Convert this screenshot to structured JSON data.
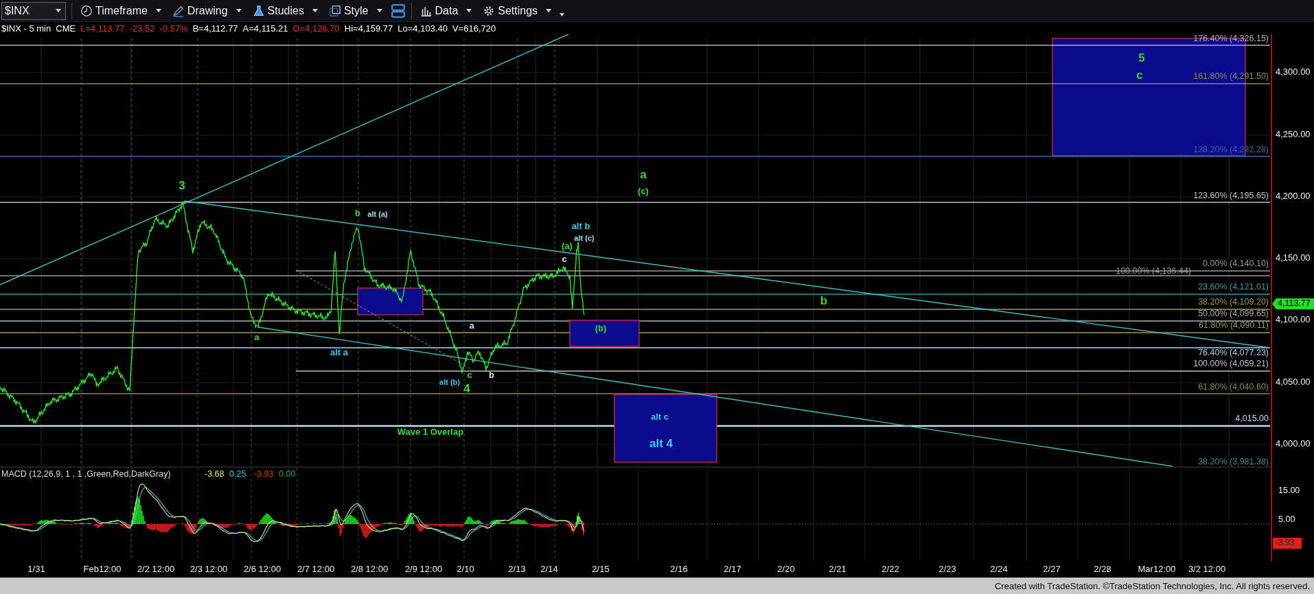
{
  "toolbar": {
    "symbol": "$INX",
    "buttons": [
      {
        "label": "Timeframe"
      },
      {
        "label": "Drawing"
      },
      {
        "label": "Studies"
      },
      {
        "label": "Style"
      },
      {
        "label": "Data"
      },
      {
        "label": "Settings"
      }
    ]
  },
  "info_line": [
    {
      "text": "$INX - 5 min",
      "color": "#ffffff"
    },
    {
      "text": "CME",
      "color": "#ffffff"
    },
    {
      "text": "L=4,113.77",
      "color": "#e03030"
    },
    {
      "text": "-23.52",
      "color": "#e03030"
    },
    {
      "text": "-0.57%",
      "color": "#e03030"
    },
    {
      "text": "B=4,112.77",
      "color": "#ffffff"
    },
    {
      "text": "A=4,115.21",
      "color": "#ffffff"
    },
    {
      "text": "O=4,126.70",
      "color": "#e03030"
    },
    {
      "text": "Hi=4,159.77",
      "color": "#ffffff"
    },
    {
      "text": "Lo=4,103.40",
      "color": "#ffffff"
    },
    {
      "text": "V=616,720",
      "color": "#ffffff"
    }
  ],
  "price_chart": {
    "price_axis": [
      "4,300.00",
      "4,250.00",
      "4,200.00",
      "4,150.00",
      "4,100.00",
      "4,050.00",
      "4,000.00"
    ],
    "last_price": "4,113.77",
    "fib_levels": [
      {
        "label": "176.40% (4,326.15)",
        "color": "#b0b0b8"
      },
      {
        "label": "161.80% (4,291.50)",
        "color": "#8c8a5a"
      },
      {
        "label": "138.20% (4,232.28)",
        "color": "#3a6aa0"
      },
      {
        "label": "123.60% (4,195.65)",
        "color": "#b8c0cc"
      },
      {
        "label": "0.00% (4,140.10)",
        "color": "#9a9aa0"
      },
      {
        "label": "100.00% (4,136.44)",
        "color": "#9a9aa0"
      },
      {
        "label": "23.60% (4,121.01)",
        "color": "#3a9a9a"
      },
      {
        "label": "38.20% (4,109.20)",
        "color": "#a09a50"
      },
      {
        "label": "50.00% (4,099.65)",
        "color": "#a8a8b0"
      },
      {
        "label": "61.80% (4,090.11)",
        "color": "#a09a50"
      },
      {
        "label": "76.40% (4,077.23)",
        "color": "#a8d8f0"
      },
      {
        "label": "100.00% (4,059.21)",
        "color": "#c0c0c8"
      },
      {
        "label": "61.80% (4,040.60)",
        "color": "#8c8a4a"
      },
      {
        "label": "4,015.00",
        "color": "#c8dcf0"
      },
      {
        "label": "38.20% (3,981.38)",
        "color": "#3a8a8a"
      }
    ],
    "wave_labels": [
      {
        "text": "5",
        "kind": "major",
        "color": "#33dd33"
      },
      {
        "text": "c",
        "kind": "major",
        "color": "#33dd33"
      },
      {
        "text": "a",
        "kind": "major",
        "color": "#33dd33"
      },
      {
        "text": "3",
        "kind": "major",
        "color": "#33dd33"
      },
      {
        "text": "(c)",
        "kind": "minor",
        "color": "#33dd33"
      },
      {
        "text": "b",
        "kind": "minor",
        "color": "#33dd33"
      },
      {
        "text": "alt (a)",
        "kind": "small",
        "color": "#a0e0f0"
      },
      {
        "text": "alt b",
        "kind": "minor",
        "color": "#40c8e8"
      },
      {
        "text": "alt (c)",
        "kind": "small",
        "color": "#a0e0f0"
      },
      {
        "text": "(a)",
        "kind": "minor",
        "color": "#33dd33"
      },
      {
        "text": "c",
        "kind": "minor",
        "color": "#e0e0e0"
      },
      {
        "text": "b",
        "kind": "major",
        "color": "#33dd33"
      },
      {
        "text": "a",
        "kind": "minor",
        "color": "#e0e0e0"
      },
      {
        "text": "(b)",
        "kind": "minor",
        "color": "#33dd33"
      },
      {
        "text": "a",
        "kind": "minor",
        "color": "#33dd33"
      },
      {
        "text": "alt a",
        "kind": "minor",
        "color": "#40c8e8"
      },
      {
        "text": "b",
        "kind": "minor",
        "color": "#e0e0e0"
      },
      {
        "text": "c",
        "kind": "minor",
        "color": "#33dd33"
      },
      {
        "text": "alt (b)",
        "kind": "small",
        "color": "#40c8e8"
      },
      {
        "text": "4",
        "kind": "major",
        "color": "#33dd33"
      },
      {
        "text": "alt c",
        "kind": "minor",
        "color": "#40c8e8"
      },
      {
        "text": "Wave 1 Overlap",
        "kind": "minor",
        "color": "#33dd33"
      },
      {
        "text": "alt 4",
        "kind": "major",
        "color": "#40c8e8"
      }
    ]
  },
  "macd": {
    "title": "MACD (12,26,9, 1 , 1 ,Green,Red,DarkGray)",
    "values": [
      {
        "text": "-3.68",
        "color": "#e8e870"
      },
      {
        "text": "0.25",
        "color": "#40c8e8"
      },
      {
        "text": "-3.93",
        "color": "#e03030"
      },
      {
        "text": "0.00",
        "color": "#30a030"
      }
    ],
    "axis": [
      "15.00",
      "5.00"
    ],
    "last_value": "-3.93"
  },
  "date_axis": [
    "1/31",
    "Feb12:00",
    "2/2 12:00",
    "2/3 12:00",
    "2/6 12:00",
    "2/7 12:00",
    "2/8 12:00",
    "2/9 12:00",
    "2/10",
    "2/13",
    "2/14",
    "2/15",
    "2/16",
    "2/17",
    "2/20",
    "2/21",
    "2/22",
    "2/23",
    "2/24",
    "2/27",
    "2/28",
    "Mar12:00",
    "3/2 12:00"
  ],
  "footer": "Created with TradeStation. ©TradeStation Technologies, Inc. All rights reserved."
}
